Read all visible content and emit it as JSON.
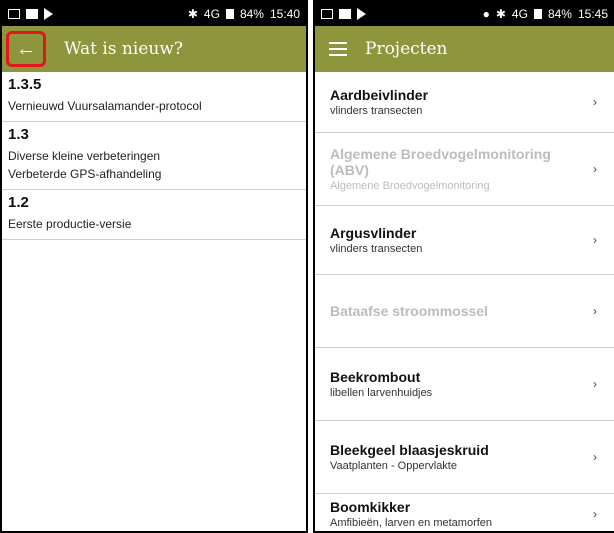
{
  "left": {
    "status": {
      "battery": "84%",
      "time": "15:40",
      "network": "4G"
    },
    "appbar": {
      "back_icon": "←",
      "title": "Wat is nieuw?"
    },
    "releases": [
      {
        "version": "1.3.5",
        "changes": [
          "Vernieuwd Vuursalamander-protocol"
        ]
      },
      {
        "version": "1.3",
        "changes": [
          "Diverse kleine verbeteringen",
          "Verbeterde GPS-afhandeling"
        ]
      },
      {
        "version": "1.2",
        "changes": [
          "Eerste productie-versie"
        ]
      }
    ]
  },
  "right": {
    "status": {
      "battery": "84%",
      "time": "15:45",
      "network": "4G"
    },
    "appbar": {
      "title": "Projecten"
    },
    "chevron": "›",
    "projects": [
      {
        "name": "Aardbeivlinder",
        "subtitle": "vlinders transecten",
        "disabled": false
      },
      {
        "name": "Algemene Broedvogelmonitoring (ABV)",
        "subtitle": "Algemene Broedvogelmonitoring",
        "disabled": true
      },
      {
        "name": "Argusvlinder",
        "subtitle": "vlinders transecten",
        "disabled": false
      },
      {
        "name": "Bataafse stroommossel",
        "subtitle": "",
        "disabled": true
      },
      {
        "name": "Beekrombout",
        "subtitle": "libellen larvenhuidjes",
        "disabled": false
      },
      {
        "name": "Bleekgeel blaasjeskruid",
        "subtitle": "Vaatplanten - Oppervlakte",
        "disabled": false
      },
      {
        "name": "Boomkikker",
        "subtitle": "Amfibieën, larven en metamorfen",
        "disabled": false
      }
    ]
  }
}
